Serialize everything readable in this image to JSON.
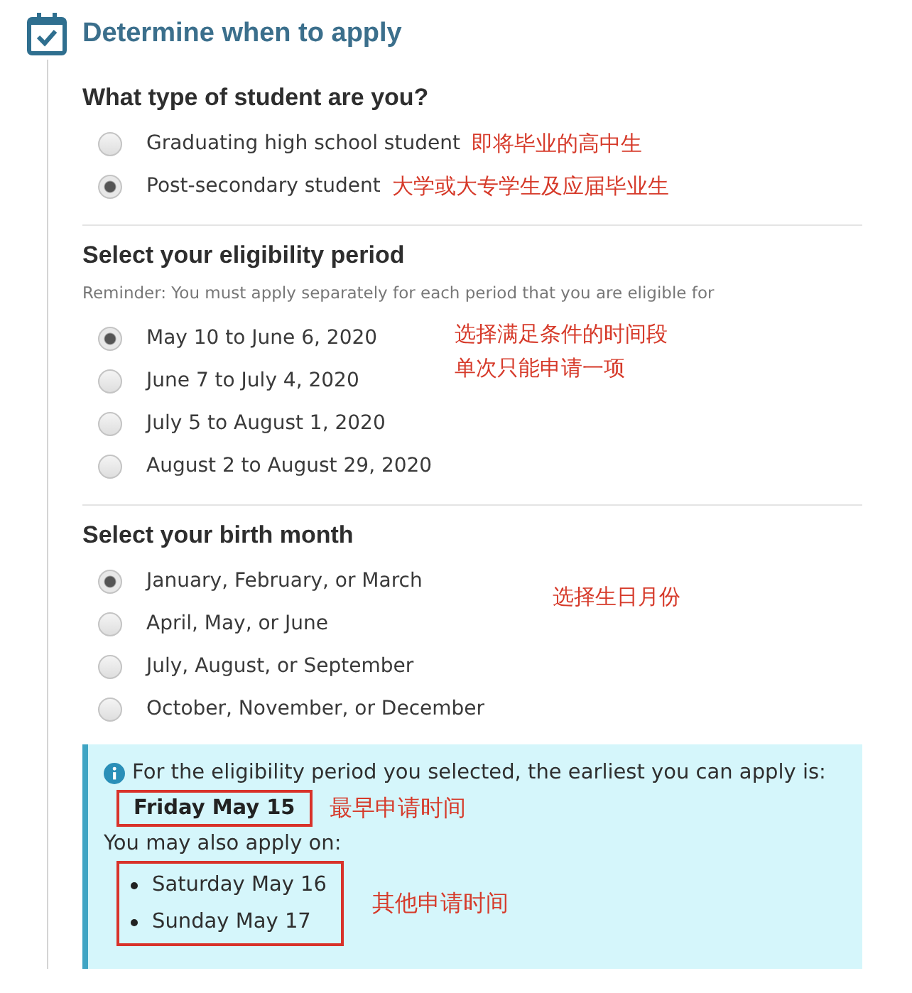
{
  "header": {
    "title": "Determine when to apply"
  },
  "sections": [
    {
      "title": "What type of student are you?",
      "options": [
        {
          "label": "Graduating high school student",
          "selected": false,
          "note": "即将毕业的高中生"
        },
        {
          "label": "Post-secondary student",
          "selected": true,
          "note": "大学或大专学生及应届毕业生"
        }
      ]
    },
    {
      "title": "Select your eligibility period",
      "reminder": "Reminder: You must apply separately for each period that you are eligible for",
      "options": [
        {
          "label": "May 10 to June 6, 2020",
          "selected": true
        },
        {
          "label": "June 7 to July 4, 2020",
          "selected": false
        },
        {
          "label": "July 5 to August 1, 2020",
          "selected": false
        },
        {
          "label": "August 2 to August 29, 2020",
          "selected": false
        }
      ],
      "note_lines": [
        "选择满足条件的时间段",
        "单次只能申请一项"
      ]
    },
    {
      "title": "Select your birth month",
      "options": [
        {
          "label": "January, February, or March",
          "selected": true
        },
        {
          "label": "April, May, or June",
          "selected": false
        },
        {
          "label": "July, August, or September",
          "selected": false
        },
        {
          "label": "October, November, or December",
          "selected": false
        }
      ],
      "note_lines": [
        "选择生日月份"
      ]
    }
  ],
  "info": {
    "message": "For the eligibility period you selected, the earliest you can apply is:",
    "earliest": "Friday May 15",
    "earliest_note": "最早申请时间",
    "also_label": "You may also apply on:",
    "also_dates": [
      "Saturday May 16",
      "Sunday May 17"
    ],
    "also_note": "其他申请时间"
  }
}
